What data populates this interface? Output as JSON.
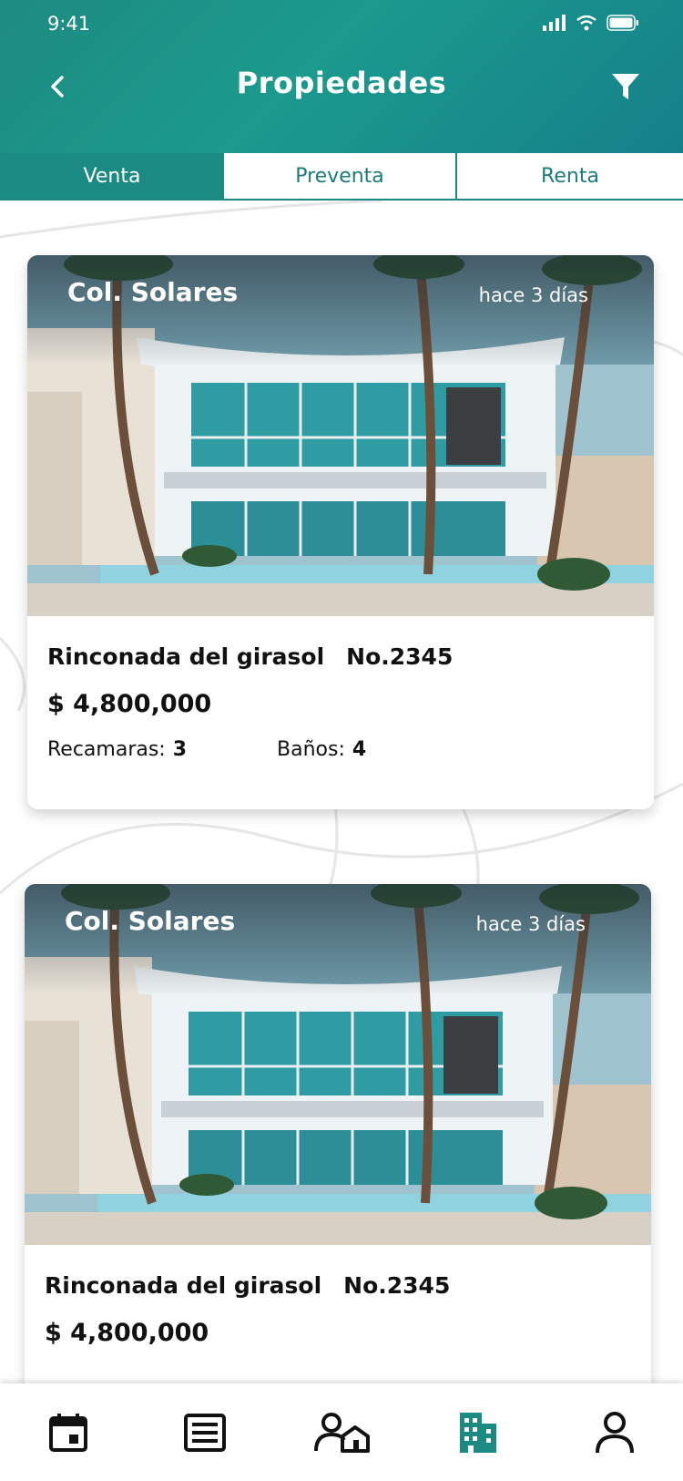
{
  "status_bar": {
    "time": "9:41"
  },
  "header": {
    "title": "Propiedades"
  },
  "tabs": [
    {
      "label": "Venta",
      "active": true
    },
    {
      "label": "Preventa",
      "active": false
    },
    {
      "label": "Renta",
      "active": false
    }
  ],
  "listings": [
    {
      "colony": "Col. Solares",
      "posted": "hace 3 días",
      "name": "Rinconada del girasol",
      "number": "No.2345",
      "price": "$ 4,800,000",
      "bedrooms_label": "Recamaras:",
      "bedrooms": "3",
      "bathrooms_label": "Baños:",
      "bathrooms": "4"
    },
    {
      "colony": "Col. Solares",
      "posted": "hace 3 días",
      "name": "Rinconada del girasol",
      "number": "No.2345",
      "price": "$ 4,800,000"
    }
  ],
  "bottom_nav": [
    {
      "icon": "calendar-icon",
      "active": false
    },
    {
      "icon": "list-icon",
      "active": false
    },
    {
      "icon": "agent-house-icon",
      "active": false
    },
    {
      "icon": "building-icon",
      "active": true
    },
    {
      "icon": "profile-icon",
      "active": false
    }
  ],
  "colors": {
    "primary": "#1b8a82",
    "text": "#111111"
  }
}
